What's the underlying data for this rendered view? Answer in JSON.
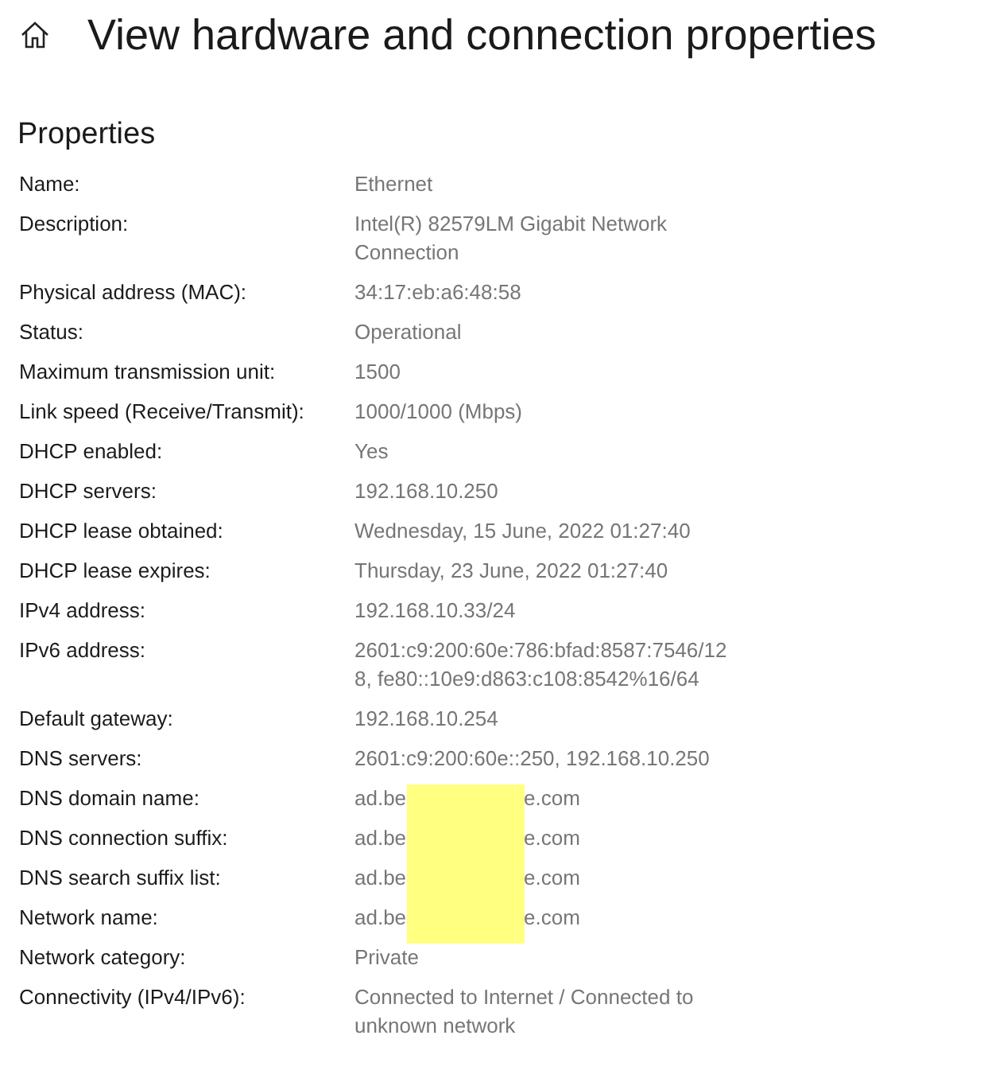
{
  "header": {
    "title": "View hardware and connection properties"
  },
  "section": {
    "title": "Properties"
  },
  "properties": [
    {
      "kind": "plain",
      "label": "Name:",
      "value": "Ethernet"
    },
    {
      "kind": "plain",
      "label": "Description:",
      "value": "Intel(R) 82579LM Gigabit Network Connection"
    },
    {
      "kind": "plain",
      "label": "Physical address (MAC):",
      "value": "34:17:eb:a6:48:58"
    },
    {
      "kind": "plain",
      "label": "Status:",
      "value": "Operational"
    },
    {
      "kind": "plain",
      "label": "Maximum transmission unit:",
      "value": "1500"
    },
    {
      "kind": "plain",
      "label": "Link speed (Receive/Transmit):",
      "value": "1000/1000 (Mbps)"
    },
    {
      "kind": "plain",
      "label": "DHCP enabled:",
      "value": "Yes"
    },
    {
      "kind": "plain",
      "label": "DHCP servers:",
      "value": "192.168.10.250"
    },
    {
      "kind": "plain",
      "label": "DHCP lease obtained:",
      "value": "Wednesday, 15 June, 2022 01:27:40"
    },
    {
      "kind": "plain",
      "label": "DHCP lease expires:",
      "value": "Thursday, 23 June, 2022 01:27:40"
    },
    {
      "kind": "plain",
      "label": "IPv4 address:",
      "value": "192.168.10.33/24"
    },
    {
      "kind": "plain",
      "label": "IPv6 address:",
      "value": "2601:c9:200:60e:786:bfad:8587:7546/128, fe80::10e9:d863:c108:8542%16/64"
    },
    {
      "kind": "plain",
      "label": "Default gateway:",
      "value": "192.168.10.254"
    },
    {
      "kind": "plain",
      "label": "DNS servers:",
      "value": "2601:c9:200:60e::250, 192.168.10.250"
    },
    {
      "kind": "redacted",
      "label": "DNS domain name:",
      "value": "ad.be",
      "value_end": "e.com"
    },
    {
      "kind": "redacted",
      "label": "DNS connection suffix:",
      "value": "ad.be",
      "value_end": "e.com"
    },
    {
      "kind": "redacted",
      "label": "DNS search suffix list:",
      "value": "ad.be",
      "value_end": "e.com"
    },
    {
      "kind": "redacted",
      "label": "Network name:",
      "value": "ad.be",
      "value_end": "e.com"
    },
    {
      "kind": "plain",
      "label": "Network category:",
      "value": "Private"
    },
    {
      "kind": "plain",
      "label": "Connectivity (IPv4/IPv6):",
      "value": "Connected to Internet / Connected to unknown network"
    }
  ]
}
